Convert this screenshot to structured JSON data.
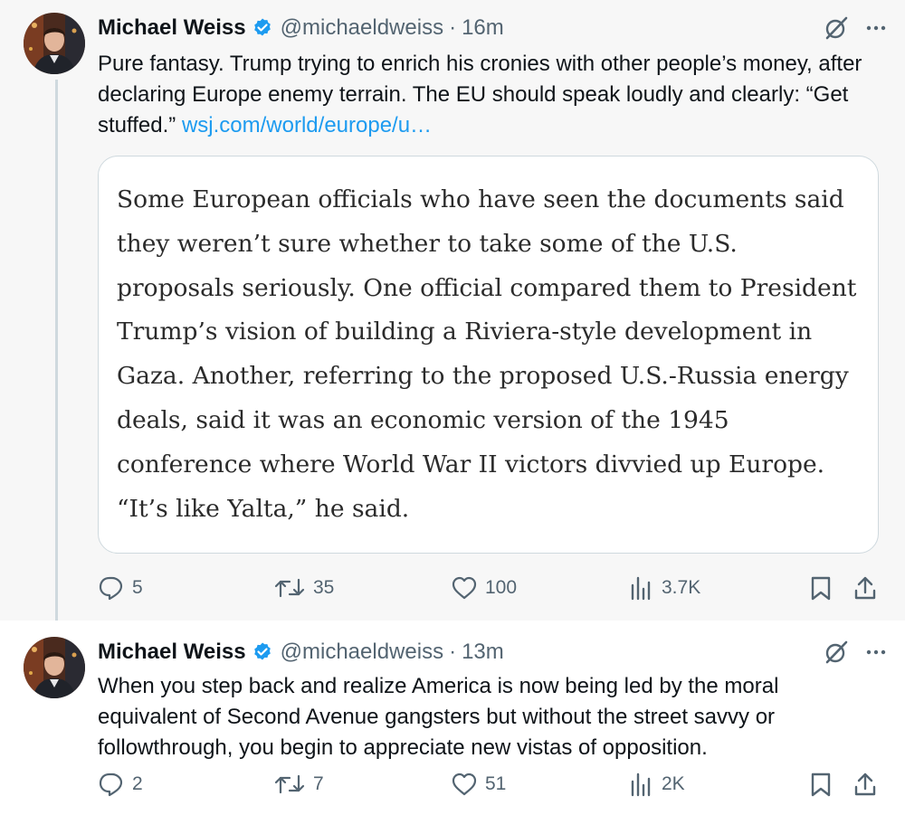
{
  "tweets": [
    {
      "author_name": "Michael Weiss",
      "handle": "@michaeldweiss",
      "separator": "·",
      "time": "16m",
      "text": "Pure fantasy. Trump trying to enrich his cronies with other people’s money, after declaring Europe enemy terrain. The EU should speak loudly and clearly: “Get stuffed.” ",
      "link": "wsj.com/world/europe/u…",
      "quote": "Some European officials who have seen the documents said they weren’t sure whether to take some of the U.S. proposals seriously. One official compared them to President Trump’s vision of building a Riviera-style development in Gaza. Another, referring to the proposed U.S.-Russia energy deals, said it was an economic version of the 1945 conference where World War II victors divvied up Europe. “It’s like Yalta,” he said.",
      "replies": "5",
      "retweets": "35",
      "likes": "100",
      "views": "3.7K"
    },
    {
      "author_name": "Michael Weiss",
      "handle": "@michaeldweiss",
      "separator": "·",
      "time": "13m",
      "text": "When you step back and realize America is now being led by the moral equivalent of Second Avenue gangsters but without the street savvy or followthrough, you begin to appreciate new vistas of opposition.",
      "replies": "2",
      "retweets": "7",
      "likes": "51",
      "views": "2K"
    }
  ],
  "icons": {
    "verified": "verified-badge-icon",
    "grok": "grok-icon",
    "more": "more-icon",
    "reply": "reply-icon",
    "retweet": "retweet-icon",
    "like": "like-icon",
    "views": "views-icon",
    "bookmark": "bookmark-icon",
    "share": "share-icon"
  },
  "colors": {
    "link": "#1d9bf0",
    "verified": "#1d9bf0",
    "secondary_text": "#536471",
    "thread_line": "#cfd9de",
    "highlight_bg": "#f7f7f7"
  }
}
